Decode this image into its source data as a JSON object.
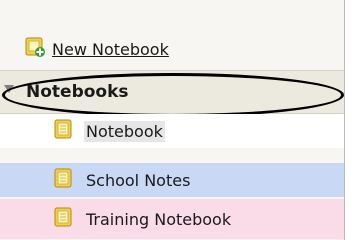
{
  "toolbar": {
    "new_notebook_label": "New Notebook",
    "new_notebook_icon": "new-notebook-icon"
  },
  "group": {
    "title": "Notebooks",
    "icon": "collapse-triangle-icon"
  },
  "notebooks": [
    {
      "label": "Notebook",
      "icon": "notebook-icon",
      "color": "#e6e6e6"
    },
    {
      "label": "School Notes",
      "icon": "notebook-icon",
      "color": "#c9d8f4"
    },
    {
      "label": "Training Notebook",
      "icon": "notebook-icon",
      "color": "#fadce8"
    }
  ],
  "colors": {
    "panel_bg": "#f7f6f2",
    "header_bg": "#ece9de",
    "icon_yellow": "#f2d24b",
    "icon_green": "#3a9a3a"
  }
}
